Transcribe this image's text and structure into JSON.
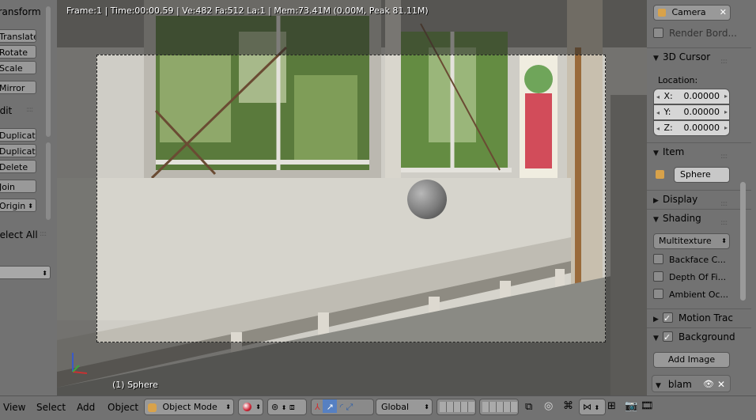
{
  "toolshelf": {
    "transform_header": "Transform",
    "translate": "Translate",
    "rotate": "Rotate",
    "scale": "Scale",
    "mirror": "Mirror",
    "edit_header": "Edit",
    "duplicate": "Duplicate",
    "duplicate_linked": "Duplicate...",
    "delete": "Delete",
    "join": "Join",
    "set_origin": "Origin",
    "operator_title": "Select All",
    "operator_dropdown": ""
  },
  "viewport": {
    "info": "Frame:1 | Time:00:00.59 | Ve:482 Fa:512 La:1 | Mem:73.41M (0.00M, Peak 81.11M)",
    "object_label": "(1) Sphere"
  },
  "properties": {
    "camera_label": "Camera",
    "render_border": "Render Bord...",
    "cursor_header": "3D Cursor",
    "location_label": "Location:",
    "x_label": "X:",
    "x_value": "0.00000",
    "y_label": "Y:",
    "y_value": "0.00000",
    "z_label": "Z:",
    "z_value": "0.00000",
    "item_header": "Item",
    "item_name": "Sphere",
    "display_header": "Display",
    "shading_header": "Shading",
    "shading_mode": "Multitexture",
    "backface": "Backface C...",
    "depth_of_field": "Depth Of Fi...",
    "ambient_occlusion": "Ambient Oc...",
    "motion_tracking": "Motion Trac",
    "background_images": "Background",
    "add_image": "Add Image",
    "image_name": "blam"
  },
  "header": {
    "view": "View",
    "select": "Select",
    "add": "Add",
    "object": "Object",
    "mode": "Object Mode",
    "orientation": "Global"
  },
  "colors": {
    "panel_bg": "#727272",
    "button_bg": "#999999",
    "field_bg": "#d6d6d6",
    "accent_blue": "#5680c2"
  }
}
